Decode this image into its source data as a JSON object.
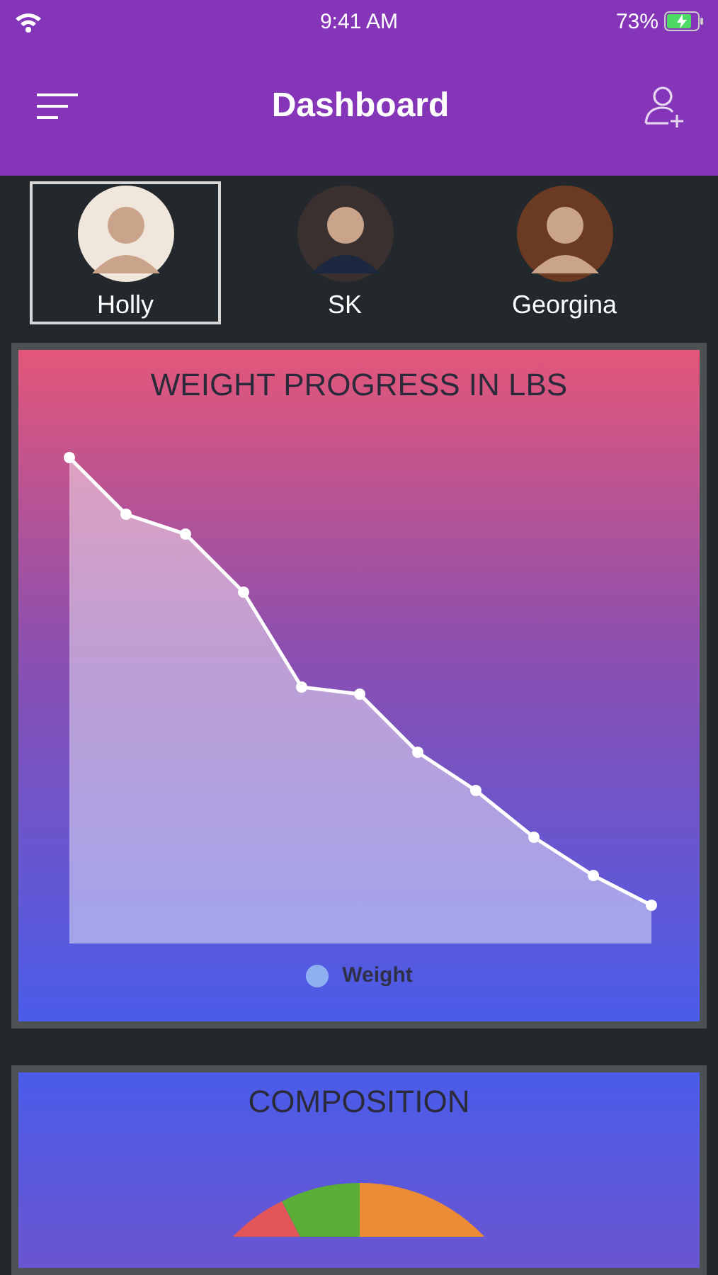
{
  "status_bar": {
    "time": "9:41 AM",
    "battery": "73%"
  },
  "header": {
    "title": "Dashboard"
  },
  "profiles": [
    {
      "name": "Holly",
      "selected": true
    },
    {
      "name": "SK",
      "selected": false
    },
    {
      "name": "Georgina",
      "selected": false
    }
  ],
  "weight_card": {
    "title": "WEIGHT PROGRESS IN LBS",
    "legend": "Weight"
  },
  "composition_card": {
    "title": "COMPOSITION"
  }
}
